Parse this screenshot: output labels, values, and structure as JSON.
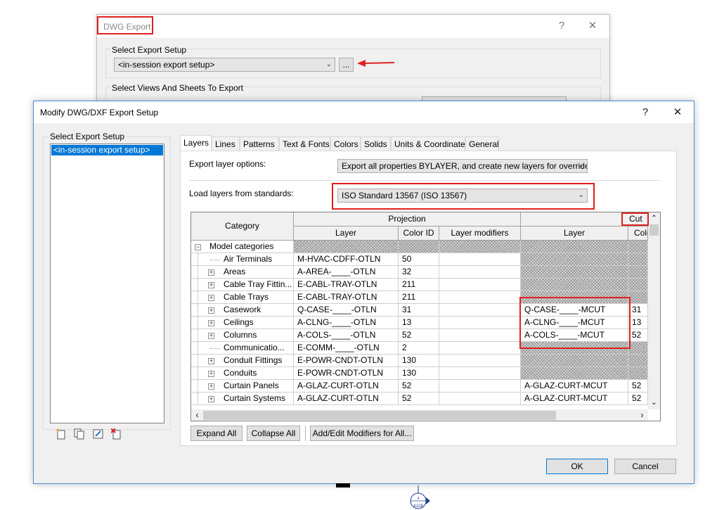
{
  "colors": {
    "highlight": "#e02020",
    "selection": "#0078d7",
    "window_border": "#4a8ad6"
  },
  "dwg_export": {
    "title": "DWG Export",
    "help_glyph": "?",
    "close_glyph": "✕",
    "setup_group_label": "Select Export Setup",
    "setup_value": "<in-session export setup>",
    "browse_button": "...",
    "views_group_label": "Select Views And Sheets To Export"
  },
  "modify_dialog": {
    "title": "Modify DWG/DXF Export Setup",
    "help_glyph": "?",
    "close_glyph": "✕",
    "setup_list_label": "Select Export Setup",
    "setup_list_items": [
      "<in-session export setup>"
    ],
    "footer_icons": [
      "new-setup-icon",
      "duplicate-setup-icon",
      "rename-setup-icon",
      "delete-setup-icon"
    ],
    "tabs": [
      "Layers",
      "Lines",
      "Patterns",
      "Text & Fonts",
      "Colors",
      "Solids",
      "Units & Coordinates",
      "General"
    ],
    "active_tab": "Layers",
    "export_layer_options_label": "Export layer options:",
    "export_layer_options_value": "Export all properties BYLAYER, and create new layers for overrides",
    "load_layers_label": "Load layers from standards:",
    "load_layers_value": "ISO Standard 13567 (ISO 13567)",
    "grid": {
      "category_header": "Category",
      "projection_header": "Projection",
      "cut_header": "Cut",
      "sub_headers": [
        "Layer",
        "Color ID",
        "Layer modifiers",
        "Layer",
        "Colo"
      ],
      "root_label": "Model categories",
      "rows": [
        {
          "category": "Air Terminals",
          "layer": "M-HVAC-CDFF-OTLN",
          "color": "50",
          "cut_layer": "",
          "cut_color": "",
          "expandable": false
        },
        {
          "category": "Areas",
          "layer": "A-AREA-____-OTLN",
          "color": "32",
          "cut_layer": "",
          "cut_color": "",
          "expandable": true
        },
        {
          "category": "Cable Tray Fittin...",
          "layer": "E-CABL-TRAY-OTLN",
          "color": "211",
          "cut_layer": "",
          "cut_color": "",
          "expandable": true
        },
        {
          "category": "Cable Trays",
          "layer": "E-CABL-TRAY-OTLN",
          "color": "211",
          "cut_layer": "",
          "cut_color": "",
          "expandable": true
        },
        {
          "category": "Casework",
          "layer": "Q-CASE-____-OTLN",
          "color": "31",
          "cut_layer": "Q-CASE-____-MCUT",
          "cut_color": "31",
          "expandable": true
        },
        {
          "category": "Ceilings",
          "layer": "A-CLNG-____-OTLN",
          "color": "13",
          "cut_layer": "A-CLNG-____-MCUT",
          "cut_color": "13",
          "expandable": true
        },
        {
          "category": "Columns",
          "layer": "A-COLS-____-OTLN",
          "color": "52",
          "cut_layer": "A-COLS-____-MCUT",
          "cut_color": "52",
          "expandable": true
        },
        {
          "category": "Communicatio...",
          "layer": "E-COMM-____-OTLN",
          "color": "2",
          "cut_layer": "",
          "cut_color": "",
          "expandable": false
        },
        {
          "category": "Conduit Fittings",
          "layer": "E-POWR-CNDT-OTLN",
          "color": "130",
          "cut_layer": "",
          "cut_color": "",
          "expandable": true
        },
        {
          "category": "Conduits",
          "layer": "E-POWR-CNDT-OTLN",
          "color": "130",
          "cut_layer": "",
          "cut_color": "",
          "expandable": true
        },
        {
          "category": "Curtain Panels",
          "layer": "A-GLAZ-CURT-OTLN",
          "color": "52",
          "cut_layer": "A-GLAZ-CURT-MCUT",
          "cut_color": "52",
          "expandable": true
        },
        {
          "category": "Curtain Systems",
          "layer": "A-GLAZ-CURT-OTLN",
          "color": "52",
          "cut_layer": "A-GLAZ-CURT-MCUT",
          "cut_color": "52",
          "expandable": true
        }
      ]
    },
    "expand_all_button": "Expand All",
    "collapse_all_button": "Collapse All",
    "add_edit_modifiers_button": "Add/Edit Modifiers for All...",
    "ok_button": "OK",
    "cancel_button": "Cancel"
  },
  "annotation_tag": {
    "top": "4",
    "bottom": "A108"
  }
}
